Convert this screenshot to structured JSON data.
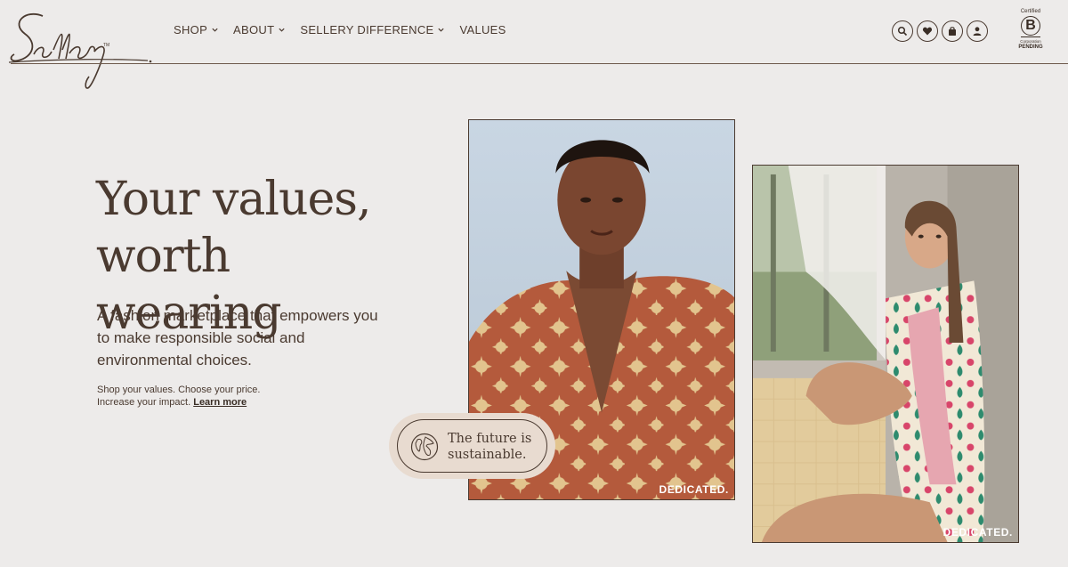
{
  "brand": {
    "name": "Sellery"
  },
  "nav": {
    "items": [
      {
        "label": "SHOP",
        "has_dropdown": true
      },
      {
        "label": "ABOUT",
        "has_dropdown": true
      },
      {
        "label": "SELLERY DIFFERENCE",
        "has_dropdown": true
      },
      {
        "label": "VALUES",
        "has_dropdown": false
      }
    ]
  },
  "header_icons": [
    "search-icon",
    "heart-icon",
    "shopping-bag-icon",
    "user-icon"
  ],
  "bcorp": {
    "top": "Certified",
    "letter": "B",
    "mid": "Corporation",
    "bottom": "PENDING"
  },
  "hero": {
    "title_line1": "Your values,",
    "title_line2": "worth wearing",
    "subtitle": "A fashion marketplace that empowers you to make responsible social and environmental choices.",
    "small_line1": "Shop your values. Choose your price.",
    "small_line2": "Increase your impact.",
    "learn_more": "Learn more"
  },
  "photos": [
    {
      "tag": "DEDICATED."
    },
    {
      "tag": "DEDICATED."
    }
  ],
  "badge": {
    "line1": "The future is",
    "line2": "sustainable."
  },
  "colors": {
    "background": "#edebea",
    "text": "#4a3a30",
    "badge_bg": "#e8dbd0"
  }
}
